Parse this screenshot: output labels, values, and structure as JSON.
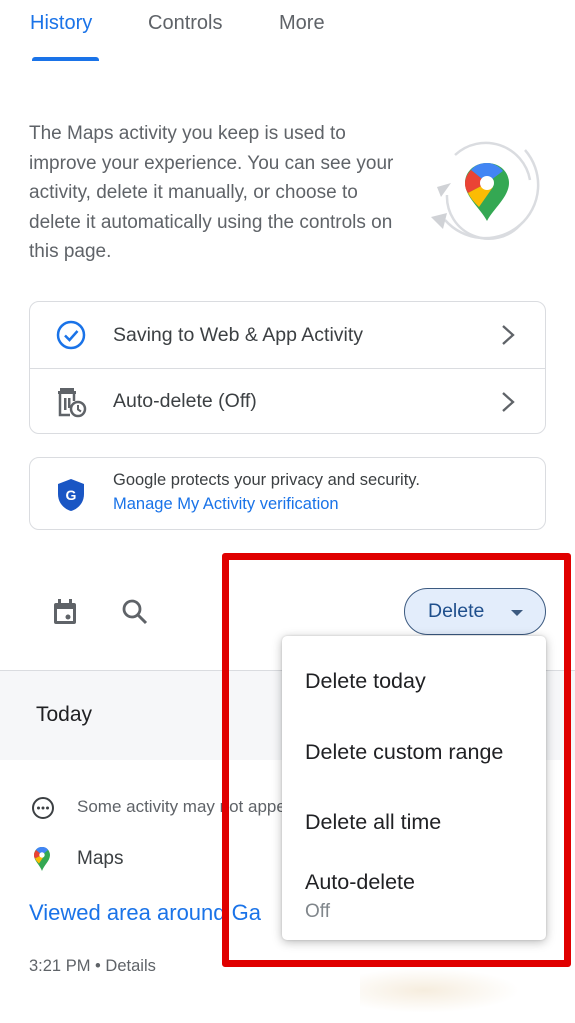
{
  "tabs": [
    {
      "label": "History",
      "active": true
    },
    {
      "label": "Controls",
      "active": false
    },
    {
      "label": "More",
      "active": false
    }
  ],
  "intro": {
    "text": "The Maps activity you keep is used to improve your experience. You can see your activity, delete it manually, or choose to delete it automatically using the controls on this page.",
    "illustration_icon": "maps-pin-cycle-icon"
  },
  "controls": [
    {
      "label": "Saving to Web & App Activity",
      "icon": "check-circle-icon"
    },
    {
      "label": "Auto-delete (Off)",
      "icon": "auto-delete-icon"
    }
  ],
  "privacy": {
    "text": "Google protects your privacy and security.",
    "link": "Manage My Activity verification",
    "icon": "google-shield-icon"
  },
  "toolbar": {
    "calendar_icon": "calendar-icon",
    "search_icon": "search-icon",
    "delete_label": "Delete"
  },
  "delete_menu": {
    "items": [
      {
        "label": "Delete today"
      },
      {
        "label": "Delete custom range"
      },
      {
        "label": "Delete all time"
      },
      {
        "label": "Auto-delete",
        "sublabel": "Off"
      }
    ]
  },
  "feed": {
    "section_label": "Today",
    "notice": "Some activity may not appear yet",
    "product": "Maps",
    "item_title": "Viewed area around Ga",
    "item_time": "3:21 PM",
    "item_details": "Details",
    "separator": "•"
  },
  "colors": {
    "accent": "#1a73e8",
    "highlight_border": "#e00000",
    "delete_button_bg": "#e3edfb"
  }
}
